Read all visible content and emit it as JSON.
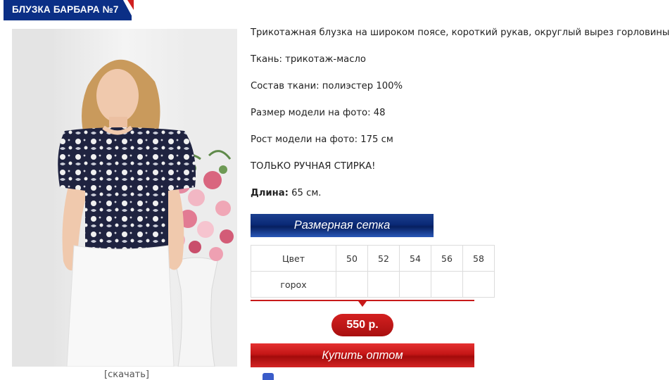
{
  "title": "БЛУЗКА БАРБАРА №7",
  "photo": {
    "download_label": "[скачать]"
  },
  "description": {
    "summary": "Трикотажная блузка на широком поясе, короткий рукав, округлый вырез горловины.",
    "fabric": "Ткань: трикотаж-масло",
    "composition": "Состав ткани: полиэстер 100%",
    "model_size": "Размер модели на фото: 48",
    "model_height": "Рост модели на фото: 175 см",
    "care": "ТОЛЬКО РУЧНАЯ СТИРКА!",
    "length_label": "Длина:",
    "length_value": "65 см."
  },
  "size_chart": {
    "label": "Размерная сетка",
    "header_label": "Цвет",
    "sizes": [
      "50",
      "52",
      "54",
      "56",
      "58"
    ],
    "rows": [
      {
        "color": "горох",
        "values": [
          "",
          "",
          "",
          "",
          ""
        ]
      }
    ]
  },
  "price": "550 р.",
  "buy_label": "Купить оптом",
  "colors": {
    "title_blue": "#0b2f86",
    "title_red": "#d01f1f",
    "banner_blue": "#0b2a77",
    "price_red": "#c81a1a"
  }
}
